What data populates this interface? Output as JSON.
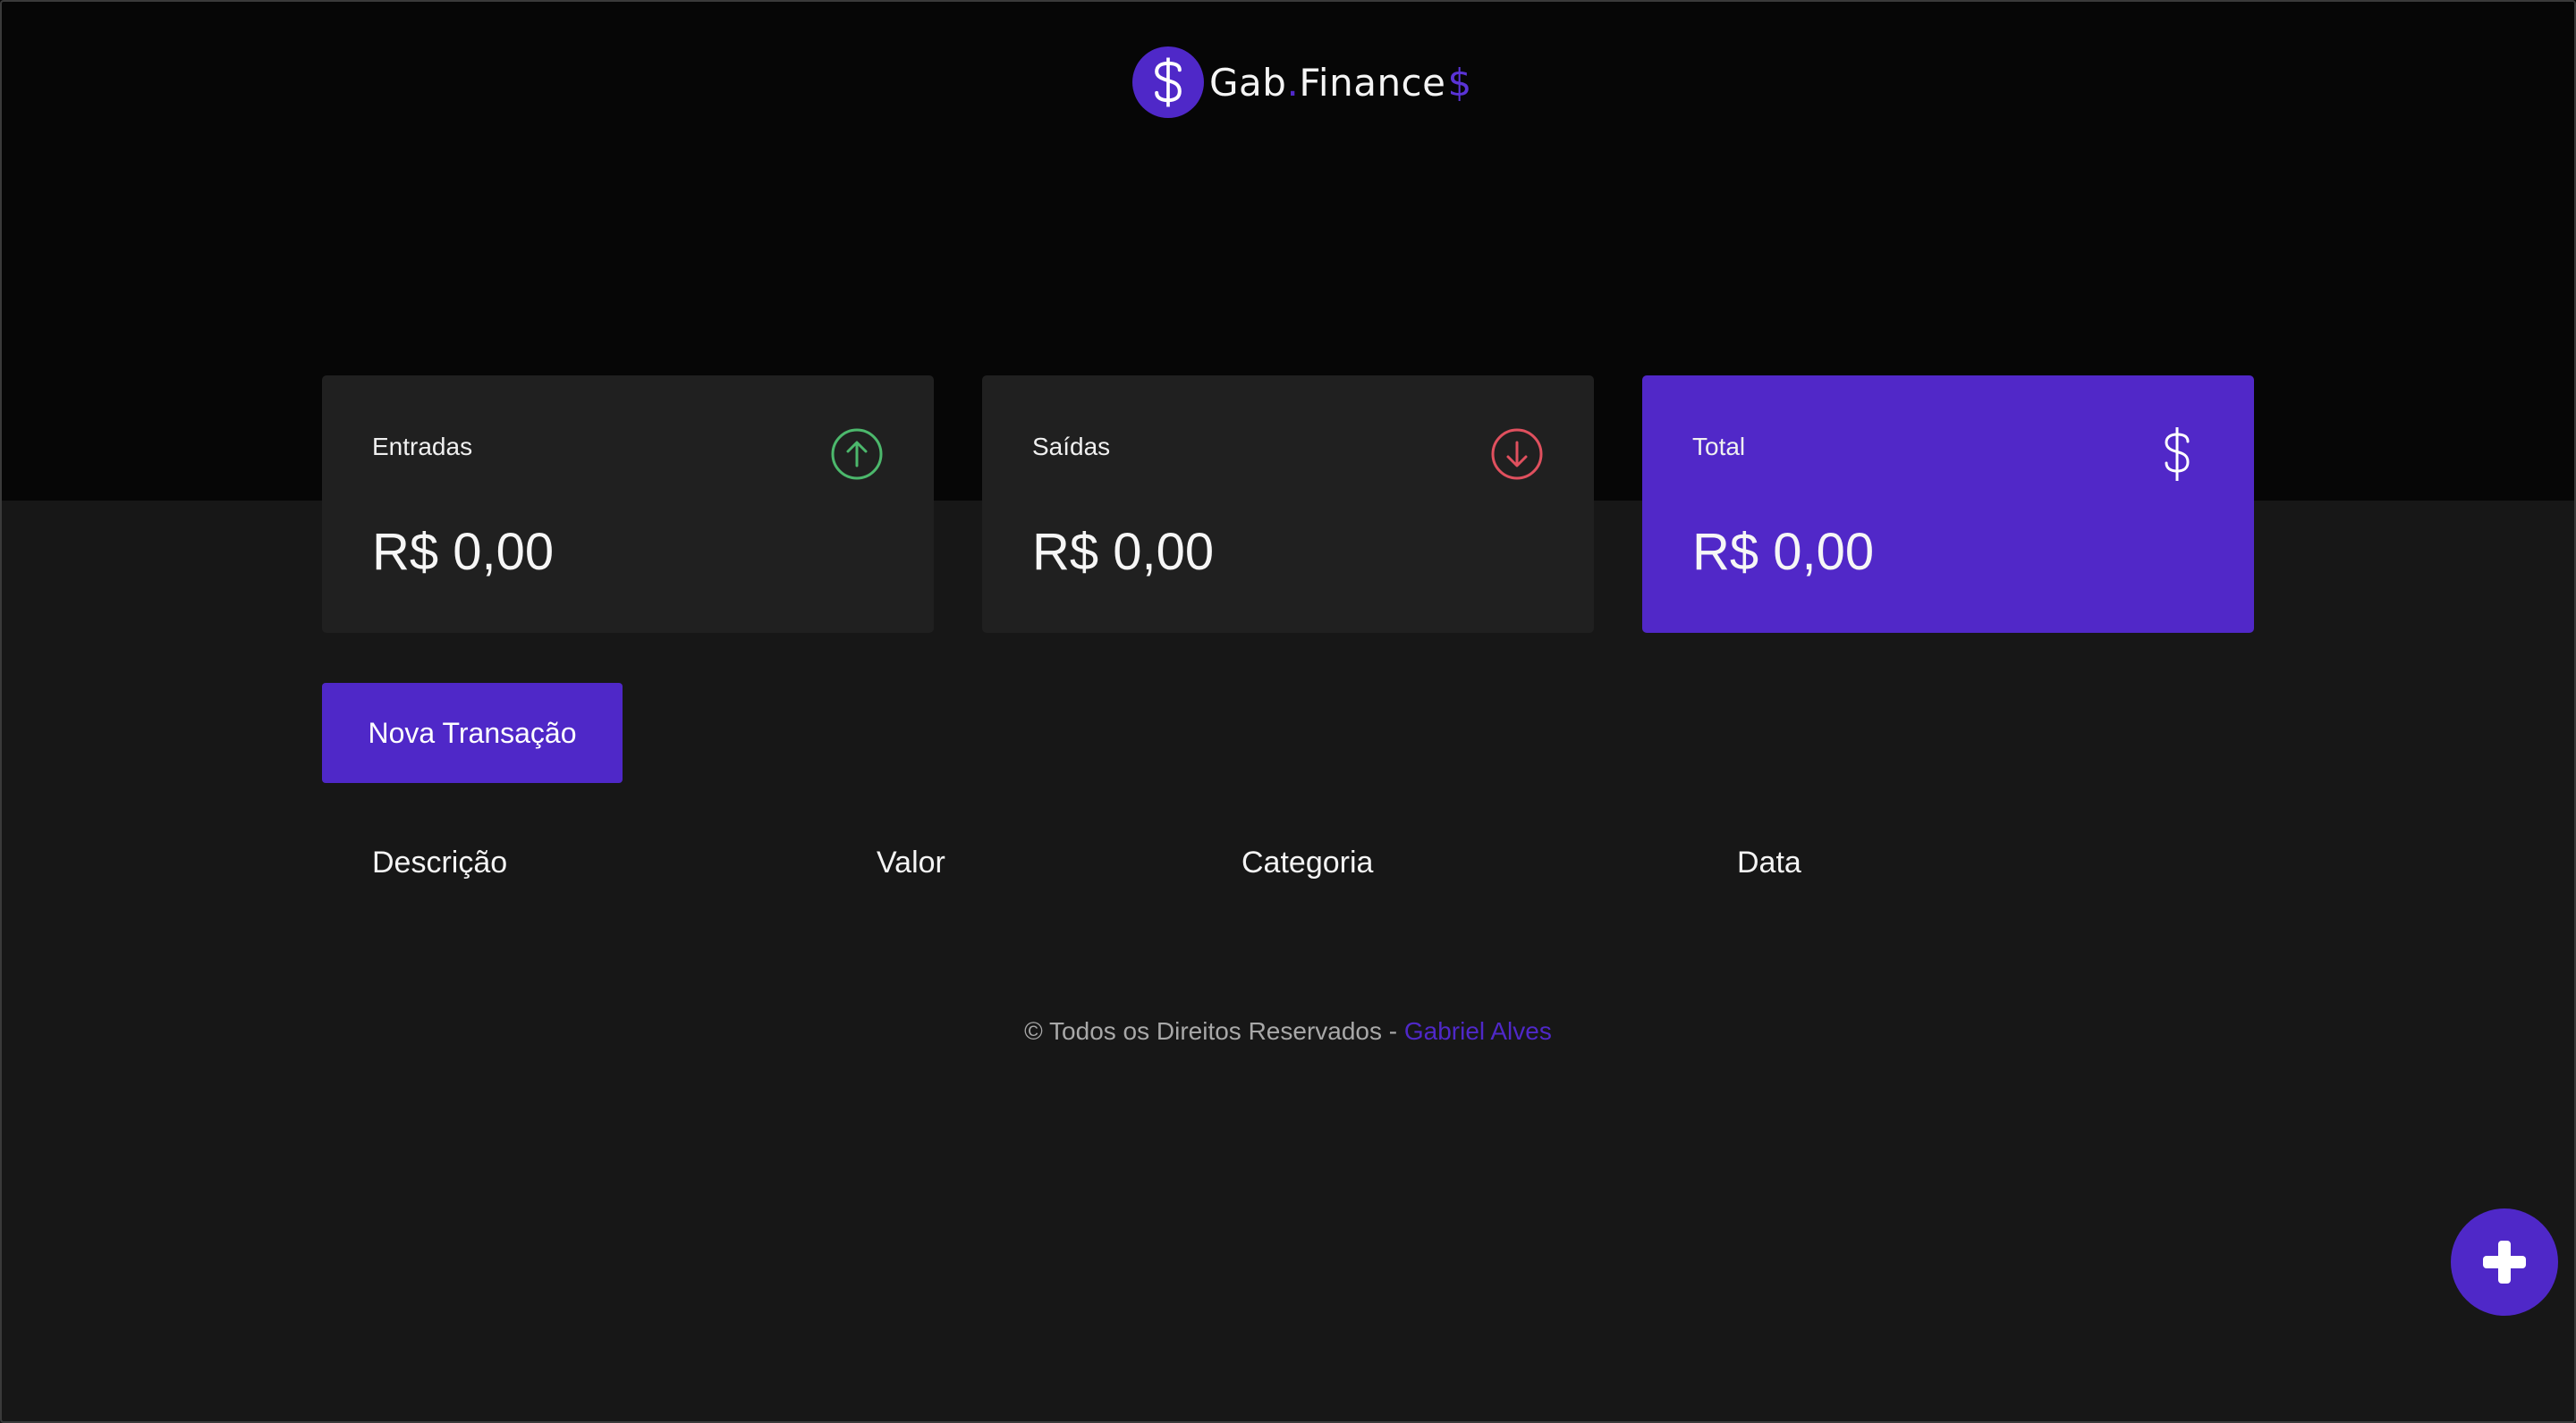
{
  "app": {
    "logo_text_main": "Gab",
    "logo_text_dot": ".",
    "logo_text_brand": "Finance",
    "logo_text_symbol": "$"
  },
  "summary": {
    "cards": [
      {
        "title": "Entradas",
        "value": "R$ 0,00",
        "icon": "arrow-up-circle-icon",
        "color": "#4cb86c"
      },
      {
        "title": "Saídas",
        "value": "R$ 0,00",
        "icon": "arrow-down-circle-icon",
        "color": "#e0505e"
      },
      {
        "title": "Total",
        "value": "R$ 0,00",
        "icon": "dollar-icon",
        "color": "#ffffff"
      }
    ]
  },
  "actions": {
    "new_transaction_label": "Nova Transação",
    "fab_icon": "plus-icon"
  },
  "table": {
    "headers": [
      "Descrição",
      "Valor",
      "Categoria",
      "Data"
    ],
    "rows": []
  },
  "footer": {
    "text": "© Todos os Direitos Reservados - ",
    "author": "Gabriel Alves"
  },
  "colors": {
    "accent": "#4f28c8",
    "income": "#4cb86c",
    "expense": "#e0505e",
    "background": "#171717",
    "header_background": "#060606",
    "card_background": "#202020"
  }
}
